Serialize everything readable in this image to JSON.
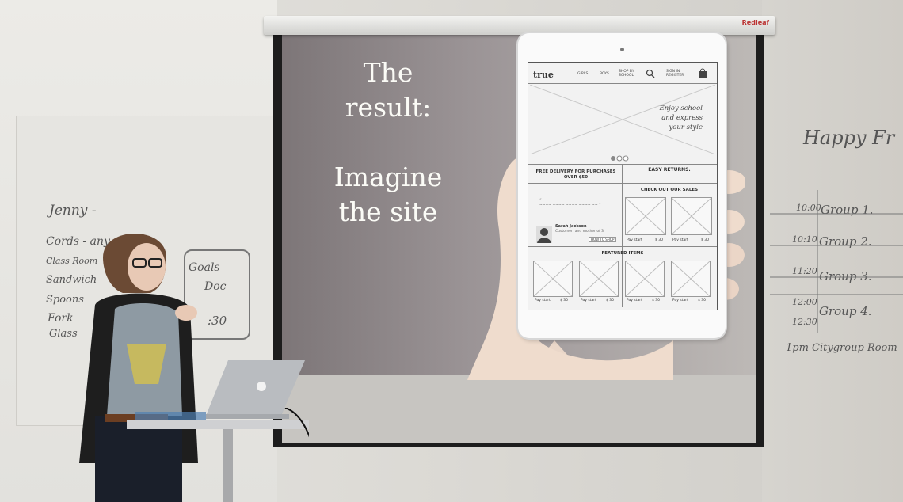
{
  "slide": {
    "lines": [
      "The",
      "result:",
      "",
      "Imagine",
      "the site"
    ]
  },
  "projector_brand": "Redleaf",
  "whiteboard_left": {
    "name": "Jenny -",
    "items": [
      "Cords - any",
      "Class Room",
      "Sandwich",
      "Spoons",
      "Fork",
      "Glass"
    ],
    "goals_box": [
      "Goals",
      "Doc",
      ":30"
    ]
  },
  "whiteboard_right": {
    "title": "Happy Fr",
    "times": [
      "10:00",
      "10:10",
      "11:20",
      "12:00",
      "12:30"
    ],
    "groups": [
      "Group 1.",
      "Group 2.",
      "Group 3.",
      "Group 4.",
      "1pm Citygroup Room"
    ]
  },
  "wireframe": {
    "logo": "true",
    "nav": [
      "GIRLS",
      "BOYS",
      "SHOP BY SCHOOL",
      "SIGN IN REGISTER"
    ],
    "hero_text": [
      "Enjoy school",
      "and express",
      "your style"
    ],
    "delivery": "FREE DELIVERY FOR PURCHASES OVER $50",
    "returns": "EASY RETURNS.",
    "sales_title": "CHECK OUT OUR SALES",
    "featured_title": "FEATURED ITEMS",
    "testimonial_name": "Sarah Jackson",
    "testimonial_role": "Customer, and mother of 3",
    "more_button": "HOW TO SHOP",
    "price_label": "Pay start",
    "price_value": "$ 30",
    "image_label": "IMAGE"
  }
}
